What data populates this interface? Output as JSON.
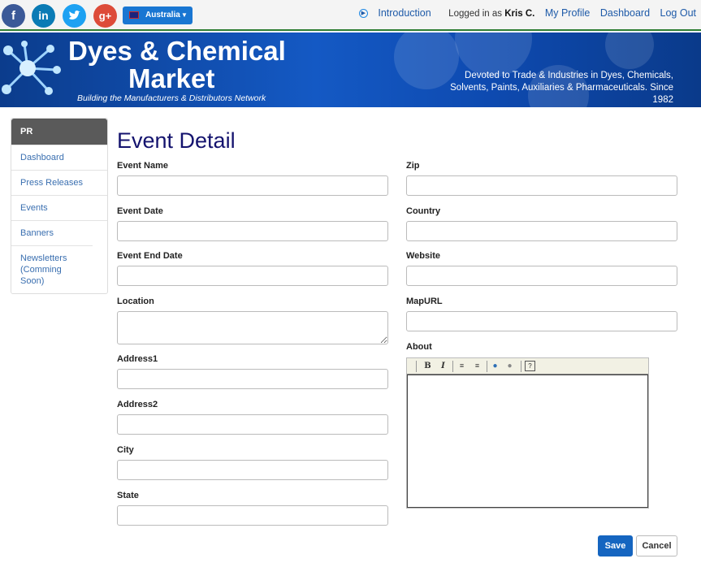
{
  "social": {
    "facebook": "f",
    "linkedin": "in",
    "twitter": "t",
    "googleplus": "g+"
  },
  "country_selector": {
    "label": "Australia"
  },
  "top_links": {
    "introduction": "Introduction",
    "logged_in_prefix": "Logged in as",
    "user_name": "Kris C.",
    "my_profile": "My Profile",
    "dashboard": "Dashboard",
    "logout": "Log Out"
  },
  "banner": {
    "brand_line1": "Dyes & Chemical",
    "brand_line2": "Market",
    "tagline": "Building the Manufacturers & Distributors Network",
    "devoted_line1": "Devoted to Trade & Industries in Dyes, Chemicals,",
    "devoted_line2": "Solvents, Paints, Auxiliaries & Pharmaceuticals. Since 1982"
  },
  "sidebar": {
    "heading": "PR",
    "items": [
      {
        "label": "Dashboard"
      },
      {
        "label": "Press Releases"
      },
      {
        "label": "Events"
      },
      {
        "label": "Banners"
      },
      {
        "label": "Newsletters (Comming Soon)"
      }
    ]
  },
  "page_title": "Event Detail",
  "form": {
    "event_name": {
      "label": "Event Name",
      "value": ""
    },
    "event_date": {
      "label": "Event Date",
      "value": ""
    },
    "event_end_date": {
      "label": "Event End Date",
      "value": ""
    },
    "location": {
      "label": "Location",
      "value": ""
    },
    "address1": {
      "label": "Address1",
      "value": ""
    },
    "address2": {
      "label": "Address2",
      "value": ""
    },
    "city": {
      "label": "City",
      "value": ""
    },
    "state": {
      "label": "State",
      "value": ""
    },
    "zip": {
      "label": "Zip",
      "value": ""
    },
    "country": {
      "label": "Country",
      "value": ""
    },
    "website": {
      "label": "Website",
      "value": ""
    },
    "mapurl": {
      "label": "MapURL",
      "value": ""
    },
    "about": {
      "label": "About",
      "value": ""
    }
  },
  "buttons": {
    "save": "Save",
    "cancel": "Cancel"
  },
  "colors": {
    "brand_blue": "#1459c4",
    "title_navy": "#14136e",
    "link_blue": "#3a6fb0",
    "save_blue": "#1565c0"
  }
}
